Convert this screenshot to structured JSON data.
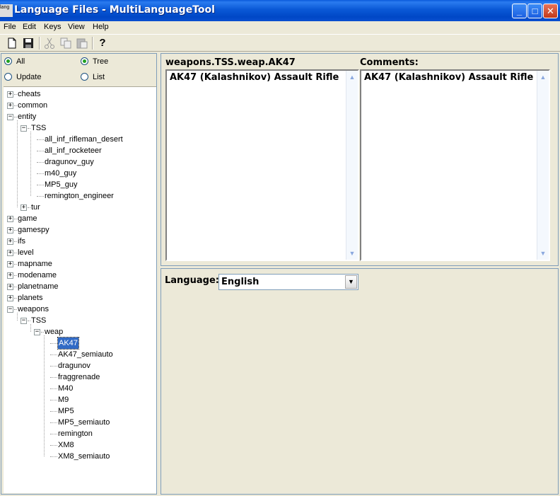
{
  "window": {
    "title": "Language Files - MultiLanguageTool",
    "app_icon_text": "lang",
    "controls": {
      "minimize": "_",
      "maximize": "□",
      "close": "✕"
    }
  },
  "menu": [
    "File",
    "Edit",
    "Keys",
    "View",
    "Help"
  ],
  "toolbar": {
    "new": "new-file-icon",
    "save": "save-icon",
    "cut": "cut-icon",
    "copy": "copy-icon",
    "paste": "paste-icon",
    "help": "help-icon",
    "help_glyph": "?"
  },
  "filters": {
    "all": "All",
    "update": "Update",
    "tree": "Tree",
    "list": "List",
    "all_checked": true,
    "tree_checked": true
  },
  "tree": {
    "expanded_glyph": "−",
    "collapsed_glyph": "+",
    "nodes": [
      {
        "label": "cheats",
        "level": 0,
        "exp": "+"
      },
      {
        "label": "common",
        "level": 0,
        "exp": "+"
      },
      {
        "label": "entity",
        "level": 0,
        "exp": "-"
      },
      {
        "label": "TSS",
        "level": 1,
        "exp": "-"
      },
      {
        "label": "all_inf_rifleman_desert",
        "level": 2,
        "exp": ""
      },
      {
        "label": "all_inf_rocketeer",
        "level": 2,
        "exp": ""
      },
      {
        "label": "dragunov_guy",
        "level": 2,
        "exp": ""
      },
      {
        "label": "m40_guy",
        "level": 2,
        "exp": ""
      },
      {
        "label": "MP5_guy",
        "level": 2,
        "exp": ""
      },
      {
        "label": "remington_engineer",
        "level": 2,
        "exp": ""
      },
      {
        "label": "tur",
        "level": 1,
        "exp": "+"
      },
      {
        "label": "game",
        "level": 0,
        "exp": "+"
      },
      {
        "label": "gamespy",
        "level": 0,
        "exp": "+"
      },
      {
        "label": "ifs",
        "level": 0,
        "exp": "+"
      },
      {
        "label": "level",
        "level": 0,
        "exp": "+"
      },
      {
        "label": "mapname",
        "level": 0,
        "exp": "+"
      },
      {
        "label": "modename",
        "level": 0,
        "exp": "+"
      },
      {
        "label": "planetname",
        "level": 0,
        "exp": "+"
      },
      {
        "label": "planets",
        "level": 0,
        "exp": "+"
      },
      {
        "label": "weapons",
        "level": 0,
        "exp": "-"
      },
      {
        "label": "TSS",
        "level": 1,
        "exp": "-"
      },
      {
        "label": "weap",
        "level": 2,
        "exp": "-"
      },
      {
        "label": "AK47",
        "level": 3,
        "exp": "",
        "selected": true
      },
      {
        "label": "AK47_semiauto",
        "level": 3,
        "exp": ""
      },
      {
        "label": "dragunov",
        "level": 3,
        "exp": ""
      },
      {
        "label": "fraggrenade",
        "level": 3,
        "exp": ""
      },
      {
        "label": "M40",
        "level": 3,
        "exp": ""
      },
      {
        "label": "M9",
        "level": 3,
        "exp": ""
      },
      {
        "label": "MP5",
        "level": 3,
        "exp": ""
      },
      {
        "label": "MP5_semiauto",
        "level": 3,
        "exp": ""
      },
      {
        "label": "remington",
        "level": 3,
        "exp": ""
      },
      {
        "label": "XM8",
        "level": 3,
        "exp": ""
      },
      {
        "label": "XM8_semiauto",
        "level": 3,
        "exp": ""
      }
    ]
  },
  "editor": {
    "key_label": "weapons.TSS.weap.AK47",
    "key_value": "AK47 (Kalashnikov) Assault Rifle",
    "comments_label": "Comments:",
    "comments_value": "AK47 (Kalashnikov) Assault Rifle",
    "scroll_up": "▲",
    "scroll_down": "▼"
  },
  "language": {
    "label": "Language:",
    "selected": "English",
    "dropdown_glyph": "▼"
  }
}
